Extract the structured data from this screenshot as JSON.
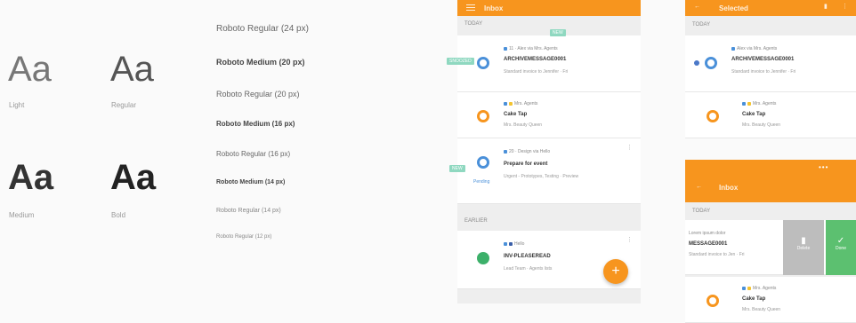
{
  "specimens": [
    {
      "glyph": "Aa",
      "caption": "Light"
    },
    {
      "glyph": "Aa",
      "caption": "Regular"
    },
    {
      "glyph": "Aa",
      "caption": "Medium"
    },
    {
      "glyph": "Aa",
      "caption": "Bold"
    }
  ],
  "type_styles": [
    "Roboto Regular (24 px)",
    "Roboto Medium (20 px)",
    "Roboto Regular (20 px)",
    "Roboto Medium (16 px)",
    "Roboto Regular (16 px)",
    "Roboto Medium (14 px)",
    "Roboto Regular (14 px)",
    "Roboto Regular (12 px)"
  ],
  "phone1": {
    "title": "Inbox",
    "section_today": "TODAY",
    "section_older": "EARLIER",
    "tag_top": "NEW",
    "tag_mid": "SNOOZED",
    "tag_low": "NEW",
    "cards": [
      {
        "meta": "11 · Alex via Mrs. Agents",
        "title": "ARCHIVEMESSAGE0001",
        "sub": "Standard invoice to Jennifer · Fri"
      },
      {
        "meta": "Mrs. Agents",
        "title": "Cake Tap",
        "sub": "Mrs. Beauty Queen"
      },
      {
        "meta": "20 · Design via Hello",
        "title": "Prepare for event",
        "sub": "Urgent - Prototypes, Testing · Preview"
      },
      {
        "meta": "Hello",
        "title": "INV-PLEASEREAD",
        "sub": "Lead Team · Agents lists"
      }
    ],
    "fab": "+",
    "side_label": "Pending"
  },
  "phone2": {
    "title": "Selected",
    "section": "TODAY",
    "cards": [
      {
        "meta": "Alex via Mrs. Agents",
        "title": "ARCHIVEMESSAGE0001",
        "sub": "Standard invoice to Jennifer · Fri"
      },
      {
        "meta": "Mrs. Agents",
        "title": "Cake Tap",
        "sub": "Mrs. Beauty Queen"
      }
    ]
  },
  "phone3": {
    "title": "Inbox",
    "dots": "•••",
    "section": "TODAY",
    "swipe_row": {
      "meta": "Lorem ipsum dolor",
      "title": "MESSAGE0001",
      "sub": "Standard invoice to Jen · Fri"
    },
    "bin_label": "Delete",
    "ok_label": "Done",
    "card": {
      "meta": "Mrs. Agents",
      "title": "Cake Tap",
      "sub": "Mrs. Beauty Queen"
    }
  },
  "colors": {
    "accent": "#f7951e",
    "blue": "#4a90d9",
    "green": "#3cb06a",
    "teal_tag": "#8fd8c0"
  }
}
